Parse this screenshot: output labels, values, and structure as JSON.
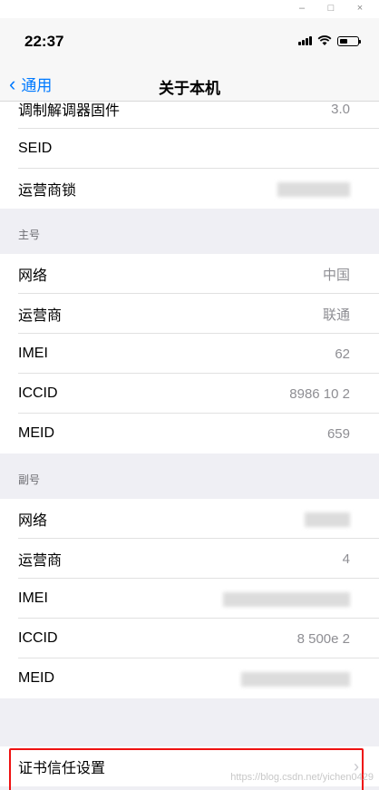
{
  "window": {
    "minimize": "–",
    "maximize": "□",
    "close": "×"
  },
  "status": {
    "time": "22:37"
  },
  "nav": {
    "back_label": "通用",
    "title": "关于本机"
  },
  "top_section": [
    {
      "label": "调制解调器固件",
      "value": "3.0"
    },
    {
      "label": "SEID",
      "value": ""
    },
    {
      "label": "运营商锁",
      "value": ""
    }
  ],
  "primary": {
    "header": "主号",
    "rows": [
      {
        "label": "网络",
        "value": "中国"
      },
      {
        "label": "运营商",
        "value": "联通"
      },
      {
        "label": "IMEI",
        "value": "62"
      },
      {
        "label": "ICCID",
        "value": "8986 10 2"
      },
      {
        "label": "MEID",
        "value": "659"
      }
    ]
  },
  "secondary": {
    "header": "副号",
    "rows": [
      {
        "label": "网络",
        "value": ""
      },
      {
        "label": "运营商",
        "value": "4"
      },
      {
        "label": "IMEI",
        "value": ""
      },
      {
        "label": "ICCID",
        "value": "8 500e 2"
      },
      {
        "label": "MEID",
        "value": ""
      }
    ]
  },
  "cert": {
    "label": "证书信任设置"
  },
  "watermark": "https://blog.csdn.net/yichen0429"
}
